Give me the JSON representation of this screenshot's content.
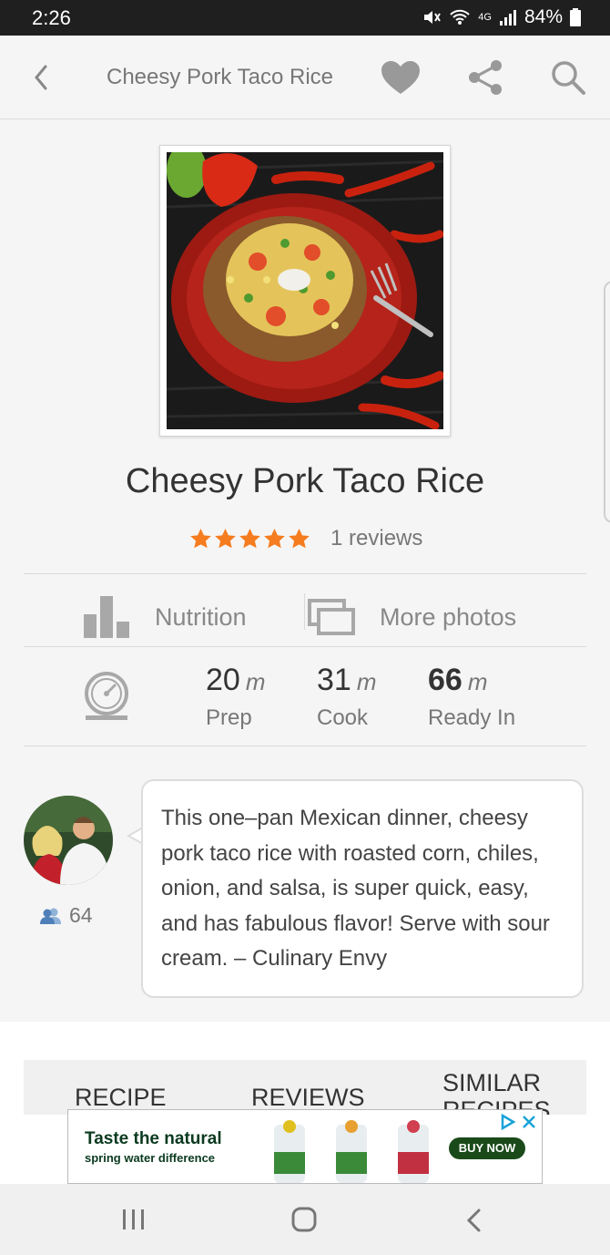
{
  "status_bar": {
    "time": "2:26",
    "network": "4G",
    "battery": "84%"
  },
  "app_bar": {
    "title": "Cheesy Pork Taco Rice",
    "back_icon": "chevron-left-icon",
    "favorite_icon": "heart-icon",
    "share_icon": "share-icon",
    "search_icon": "search-icon"
  },
  "recipe": {
    "title": "Cheesy Pork Taco Rice",
    "rating": 5,
    "max_rating": 5,
    "reviews_text": "1 reviews",
    "nutrition_label": "Nutrition",
    "more_photos_label": "More photos",
    "times": [
      {
        "value": "20",
        "unit": "m",
        "label": "Prep"
      },
      {
        "value": "31",
        "unit": "m",
        "label": "Cook"
      },
      {
        "value": "66",
        "unit": "m",
        "label": "Ready In"
      }
    ],
    "author_followers": "64",
    "description": "This one–pan Mexican dinner, cheesy pork taco rice with roasted corn, chiles, onion, and salsa, is super quick, easy, and has fabulous flavor! Serve with sour cream. – Culinary Envy"
  },
  "tabs": [
    {
      "label": "RECIPE"
    },
    {
      "label": "REVIEWS"
    },
    {
      "label": "SIMILAR RECIPES"
    }
  ],
  "ad": {
    "headline": "Taste the natural",
    "subline": "spring water difference",
    "cta": "BUY NOW"
  },
  "colors": {
    "star": "#f57c1f",
    "status_bar_bg": "#1f1f1f",
    "icon_gray": "#9e9e9e"
  }
}
